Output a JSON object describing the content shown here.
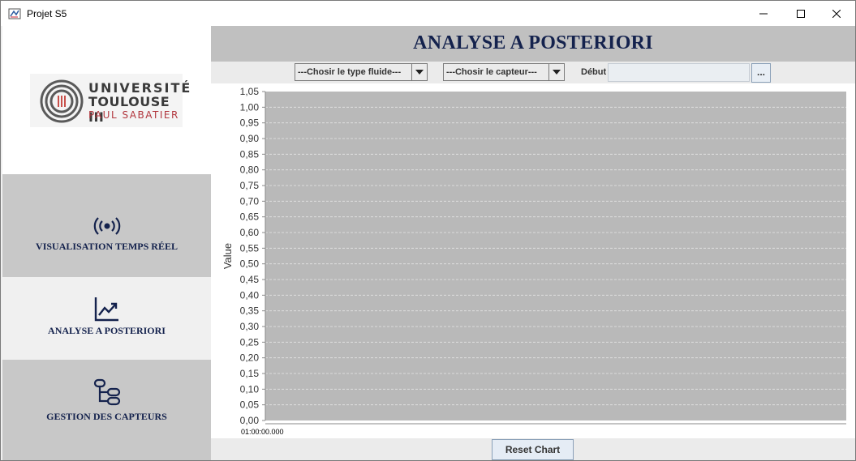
{
  "window": {
    "title": "Projet S5"
  },
  "logo": {
    "line1": "UNIVERSITÉ",
    "line2": "TOULOUSE III",
    "line3": "PAUL SABATIER",
    "accent_color": "#b2373e"
  },
  "sidebar": {
    "items": [
      {
        "label": "VISUALISATION TEMPS RÉEL",
        "icon": "broadcast-icon",
        "active": false
      },
      {
        "label": "ANALYSE A POSTERIORI",
        "icon": "trending-chart-icon",
        "active": true
      },
      {
        "label": "GESTION DES CAPTEURS",
        "icon": "device-hub-icon",
        "active": false
      }
    ]
  },
  "header": {
    "title": "ANALYSE A POSTERIORI"
  },
  "controls": {
    "fluid_select": "---Chosir le type fluide---",
    "sensor_select": "---Chosir le capteur---",
    "debut_label": "Début",
    "debut_value": "",
    "browse_label": "..."
  },
  "chart_data": {
    "type": "line",
    "ylabel": "Value",
    "xlabel": "",
    "ylim": [
      0,
      1.05
    ],
    "yticks": [
      "1,05",
      "1,00",
      "0,95",
      "0,90",
      "0,85",
      "0,80",
      "0,75",
      "0,70",
      "0,65",
      "0,60",
      "0,55",
      "0,50",
      "0,45",
      "0,40",
      "0,35",
      "0,30",
      "0,25",
      "0,20",
      "0,15",
      "0,10",
      "0,05",
      "0,00"
    ],
    "xticks": [
      "01:00:00.000"
    ],
    "grid": true,
    "series": [],
    "plot_bg": "#b9b9b9"
  },
  "footer": {
    "reset_label": "Reset Chart"
  },
  "colors": {
    "navy": "#14224d",
    "sidebar_bg": "#c8c8c8",
    "active_bg": "#f0f0f0"
  }
}
